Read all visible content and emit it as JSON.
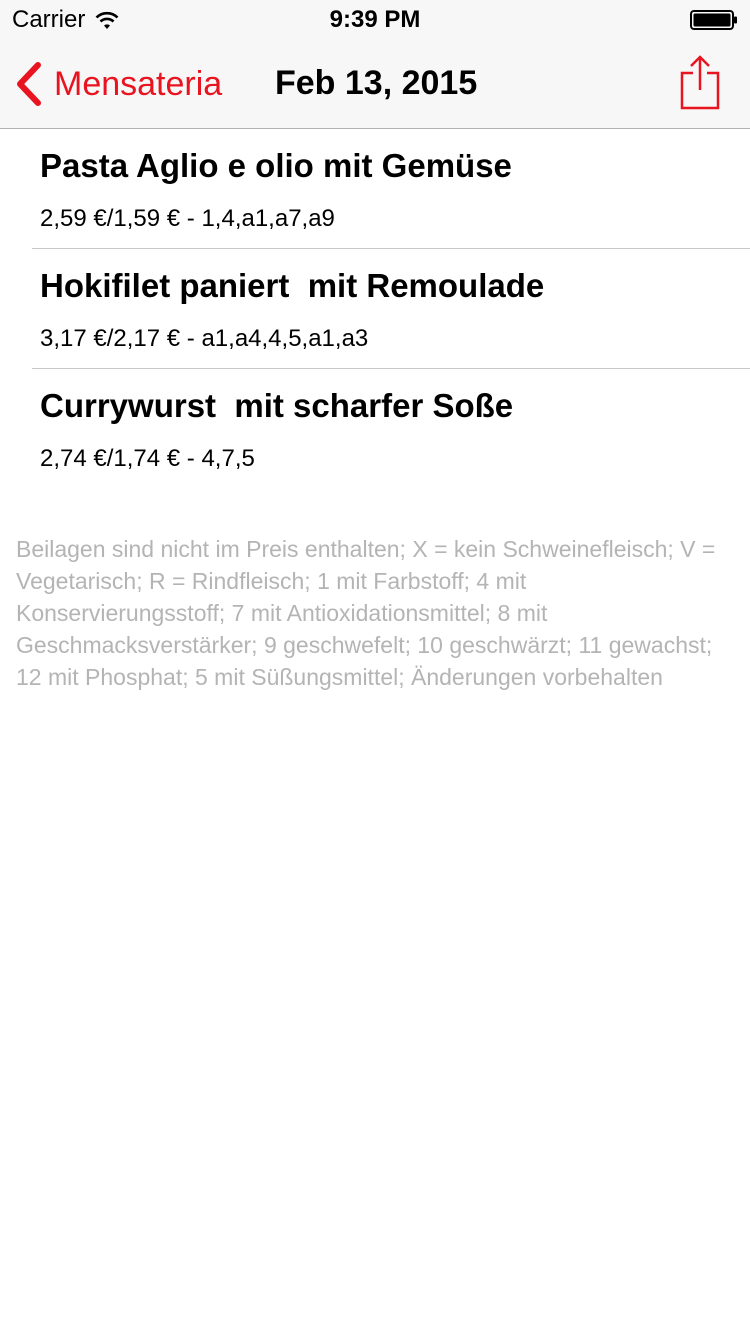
{
  "status_bar": {
    "carrier": "Carrier",
    "time": "9:39 PM"
  },
  "nav_bar": {
    "back_label": "Mensateria",
    "title": "Feb 13, 2015",
    "accent_color": "#e8141f",
    "back_icon": "chevron-left-icon",
    "share_icon": "share-icon"
  },
  "menu": {
    "items": [
      {
        "name": "Pasta Aglio e olio mit Gemüse",
        "details": "2,59 €/1,59 € - 1,4,a1,a7,a9"
      },
      {
        "name": "Hokifilet paniert  mit Remoulade",
        "details": "3,17 €/2,17 € - a1,a4,4,5,a1,a3"
      },
      {
        "name": "Currywurst  mit scharfer Soße",
        "details": "2,74 €/1,74 € - 4,7,5"
      }
    ]
  },
  "footnote": "Beilagen sind nicht im Preis enthalten; X = kein Schweinefleisch; V = Vegetarisch; R = Rindfleisch; 1 mit Farbstoff; 4 mit Konservierungsstoff; 7 mit Antioxidationsmittel; 8 mit Geschmacksverstärker; 9 geschwefelt; 10 geschwärzt; 11 gewachst; 12 mit Phosphat; 5 mit Süßungsmittel; Änderungen vorbehalten"
}
